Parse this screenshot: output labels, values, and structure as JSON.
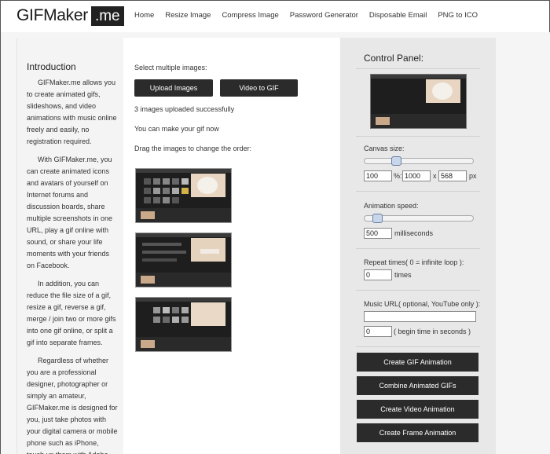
{
  "logo": {
    "main": "GIFMaker",
    "box": ".me"
  },
  "nav": [
    "Home",
    "Resize Image",
    "Compress Image",
    "Password Generator",
    "Disposable Email",
    "PNG to ICO"
  ],
  "intro": {
    "title": "Introduction",
    "paragraphs": [
      "GIFMaker.me allows you to create animated gifs, slideshows, and video animations with music online freely and easily, no registration required.",
      "With GIFMaker.me, you can create animated icons and avatars of yourself on Internet forums and discussion boards, share multiple screenshots in one URL, play a gif online with sound, or share your life moments with your friends on Facebook.",
      "In addition, you can reduce the file size of a gif, resize a gif, reverse a gif, merge / join two or more gifs into one gif online, or split a gif into separate frames.",
      "Regardless of whether you are a professional designer, photographer or simply an amateur, GIFMaker.me is designed for you, just take photos with your digital camera or mobile phone such as iPhone, touch up them with Adobe"
    ]
  },
  "main": {
    "select_label": "Select multiple images:",
    "upload_button": "Upload Images",
    "video_button": "Video to GIF",
    "upload_status": "3 images uploaded successfully",
    "make_now": "You can make your gif now",
    "drag_hint": "Drag the images to change the order:"
  },
  "control_panel": {
    "title": "Control Panel:",
    "canvas_size": {
      "label": "Canvas size:",
      "percent": "100",
      "percent_unit": "%:",
      "width": "1000",
      "x_sep": "x",
      "height": "568",
      "px_unit": "px",
      "slider_fraction": 0.27
    },
    "animation_speed": {
      "label": "Animation speed:",
      "value": "500",
      "unit": "milliseconds",
      "slider_fraction": 0.08
    },
    "repeat": {
      "label": "Repeat times( 0 = infinite loop ):",
      "value": "0",
      "unit": "times"
    },
    "music": {
      "label": "Music URL( optional, YouTube only ):",
      "url": "",
      "begin": "0",
      "begin_unit": "( begin time in seconds )"
    },
    "buttons": [
      "Create GIF Animation",
      "Combine Animated GIFs",
      "Create Video Animation",
      "Create Frame Animation"
    ]
  },
  "colors": {
    "dark_button": "#2b2b2b",
    "panel_bg": "#e8e8e8",
    "slider_knob": "#c7d6ea"
  }
}
